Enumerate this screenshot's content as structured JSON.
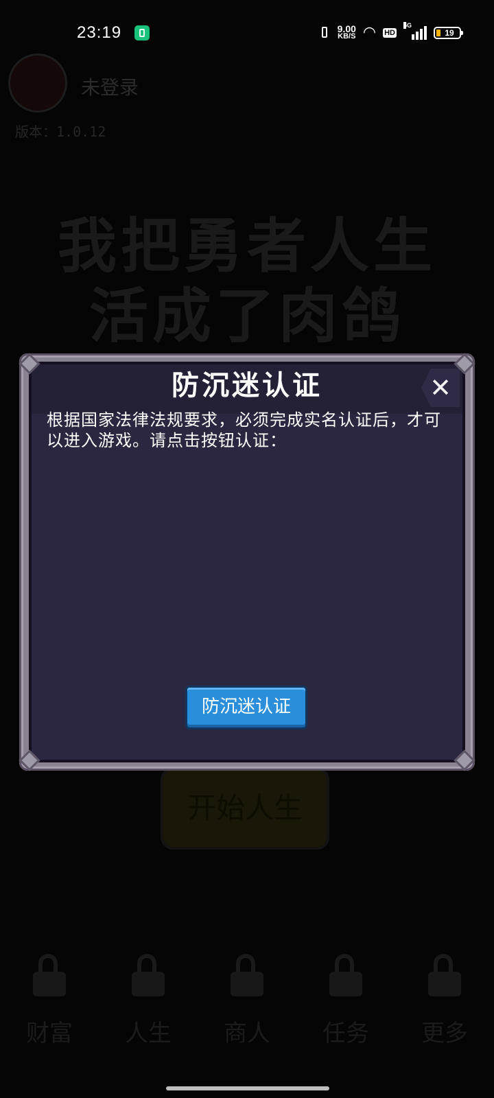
{
  "status_bar": {
    "time": "23:19",
    "net_speed_value": "9.00",
    "net_speed_unit": "KB/S",
    "hd_label": "HD",
    "network_label": "5G",
    "battery_level": "19",
    "battery_color": "#ffb300",
    "app_notification_color": "#19c27a"
  },
  "background": {
    "username": "未登录",
    "version": "版本：1.0.12",
    "game_title_line1": "我把勇者人生",
    "game_title_line2": "活成了肉鸽",
    "start_button_label": "开始人生",
    "nav": [
      {
        "label": "财富",
        "icon": "lock-icon"
      },
      {
        "label": "人生",
        "icon": "lock-icon"
      },
      {
        "label": "商人",
        "icon": "lock-icon"
      },
      {
        "label": "任务",
        "icon": "lock-icon"
      },
      {
        "label": "更多",
        "icon": "ship-icon"
      }
    ]
  },
  "dialog": {
    "title": "防沉迷认证",
    "close_icon": "close-icon",
    "message": "根据国家法律法规要求，必须完成实名认证后，才可以进入游戏。请点击按钮认证：",
    "verify_button_label": "防沉迷认证",
    "accent_color": "#2b8edb",
    "panel_color": "#2c2740"
  }
}
